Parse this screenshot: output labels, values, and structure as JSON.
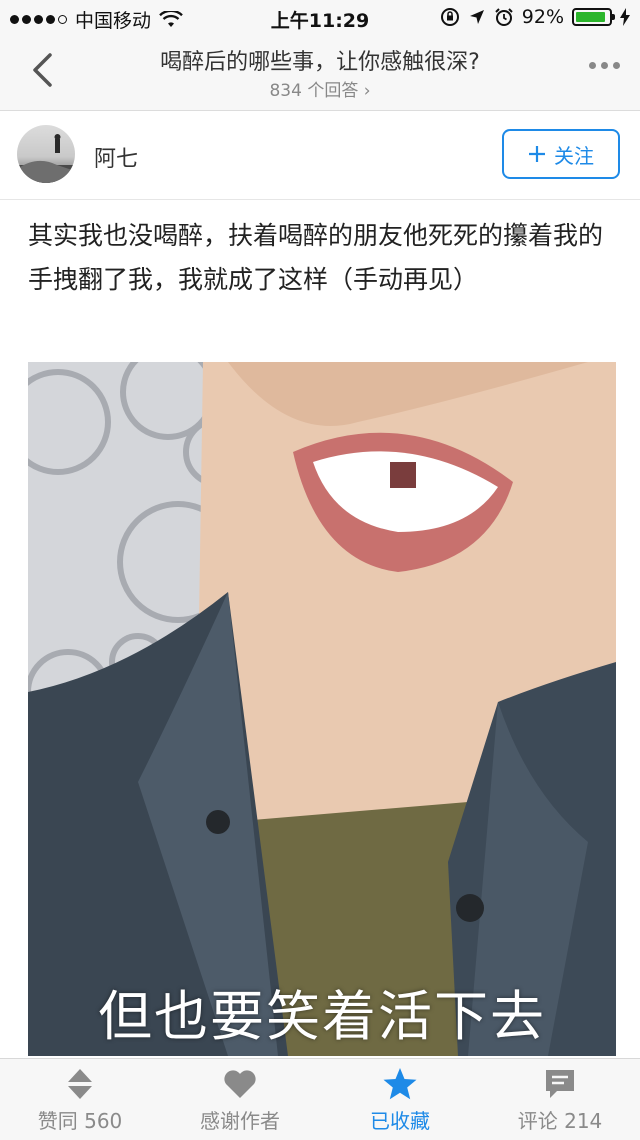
{
  "status_bar": {
    "carrier": "中国移动",
    "time": "上午11:29",
    "battery_percent": "92%",
    "battery_level": 0.92,
    "battery_color": "#2bb52b"
  },
  "header": {
    "title": "喝醉后的哪些事，让你感触很深?",
    "answers_count": "834 个回答 ›"
  },
  "author": {
    "name": "阿七",
    "follow_label": "关注"
  },
  "answer": {
    "text": "其实我也没喝醉，扶着喝醉的朋友他死死的攥着我的手拽翻了我，我就成了这样（手动再见）",
    "image_caption": "但也要笑着活下去"
  },
  "tabbar": {
    "items": [
      {
        "label": "赞同 560",
        "icon": "vote-icon",
        "active": false
      },
      {
        "label": "感谢作者",
        "icon": "heart-icon",
        "active": false
      },
      {
        "label": "已收藏",
        "icon": "star-icon",
        "active": true
      },
      {
        "label": "评论 214",
        "icon": "comment-icon",
        "active": false
      }
    ]
  },
  "colors": {
    "accent": "#1e8ae7",
    "inactive": "#8a8a8a"
  }
}
